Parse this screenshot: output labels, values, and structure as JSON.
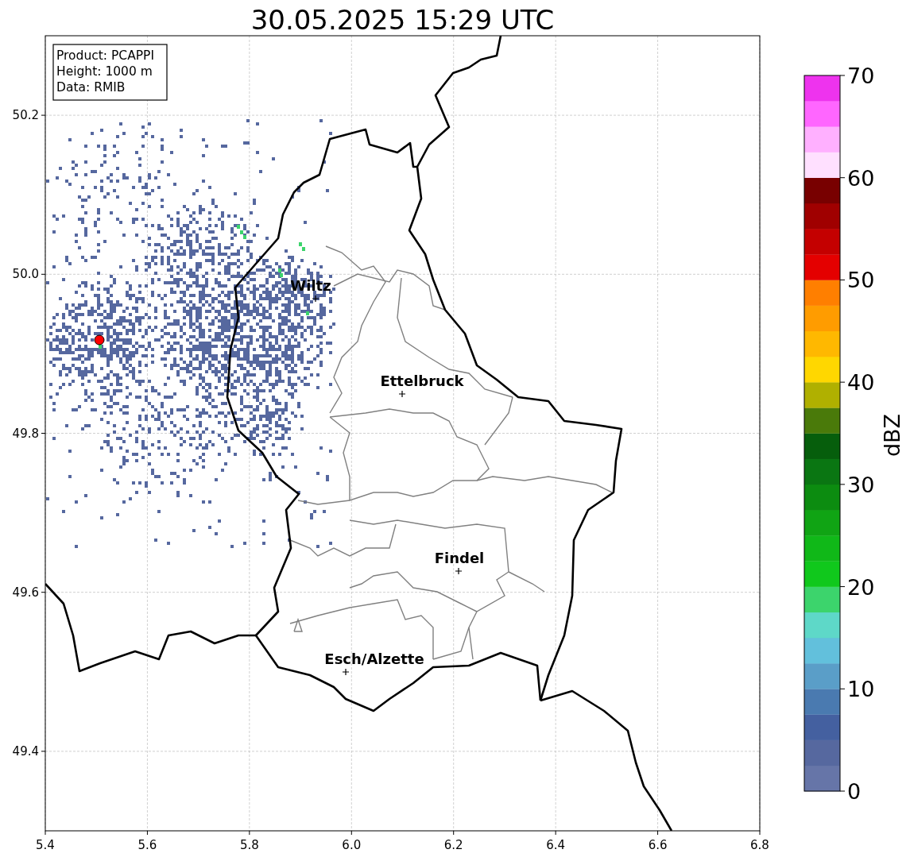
{
  "title": "30.05.2025 15:29 UTC",
  "info_box": [
    "Product: PCAPPI",
    "Height: 1000 m",
    "Data: RMIB"
  ],
  "map": {
    "xticks": [
      "5.4",
      "5.6",
      "5.8",
      "6.0",
      "6.2",
      "6.4",
      "6.6",
      "6.8"
    ],
    "yticks": [
      "50.2",
      "50.0",
      "49.8",
      "49.6",
      "49.4"
    ],
    "cities": [
      {
        "label": "Wiltz"
      },
      {
        "label": "Ettelbruck"
      },
      {
        "label": "Findel"
      },
      {
        "label": "Esch/Alzette"
      }
    ]
  },
  "colorbar": {
    "label": "dBZ",
    "ticks": [
      "70",
      "60",
      "50",
      "40",
      "30",
      "20",
      "10",
      "0"
    ],
    "bins": [
      {
        "color": "#6675a8"
      },
      {
        "color": "#56689f"
      },
      {
        "color": "#4460a0"
      },
      {
        "color": "#4a7ab0"
      },
      {
        "color": "#5a9ec8"
      },
      {
        "color": "#62c0dc"
      },
      {
        "color": "#5ed8c8"
      },
      {
        "color": "#3cd46c"
      },
      {
        "color": "#10c81c"
      },
      {
        "color": "#10b818"
      },
      {
        "color": "#10a414"
      },
      {
        "color": "#0c8c10"
      },
      {
        "color": "#0a7612"
      },
      {
        "color": "#065e0c"
      },
      {
        "color": "#4a7a0a"
      },
      {
        "color": "#b0b000"
      },
      {
        "color": "#ffd700"
      },
      {
        "color": "#ffb800"
      },
      {
        "color": "#ff9c00"
      },
      {
        "color": "#ff7f00"
      },
      {
        "color": "#e40000"
      },
      {
        "color": "#c40000"
      },
      {
        "color": "#a00000"
      },
      {
        "color": "#780000"
      },
      {
        "color": "#ffe0ff"
      },
      {
        "color": "#ffb0ff"
      },
      {
        "color": "#ff66ff"
      },
      {
        "color": "#ee33ee"
      }
    ]
  }
}
